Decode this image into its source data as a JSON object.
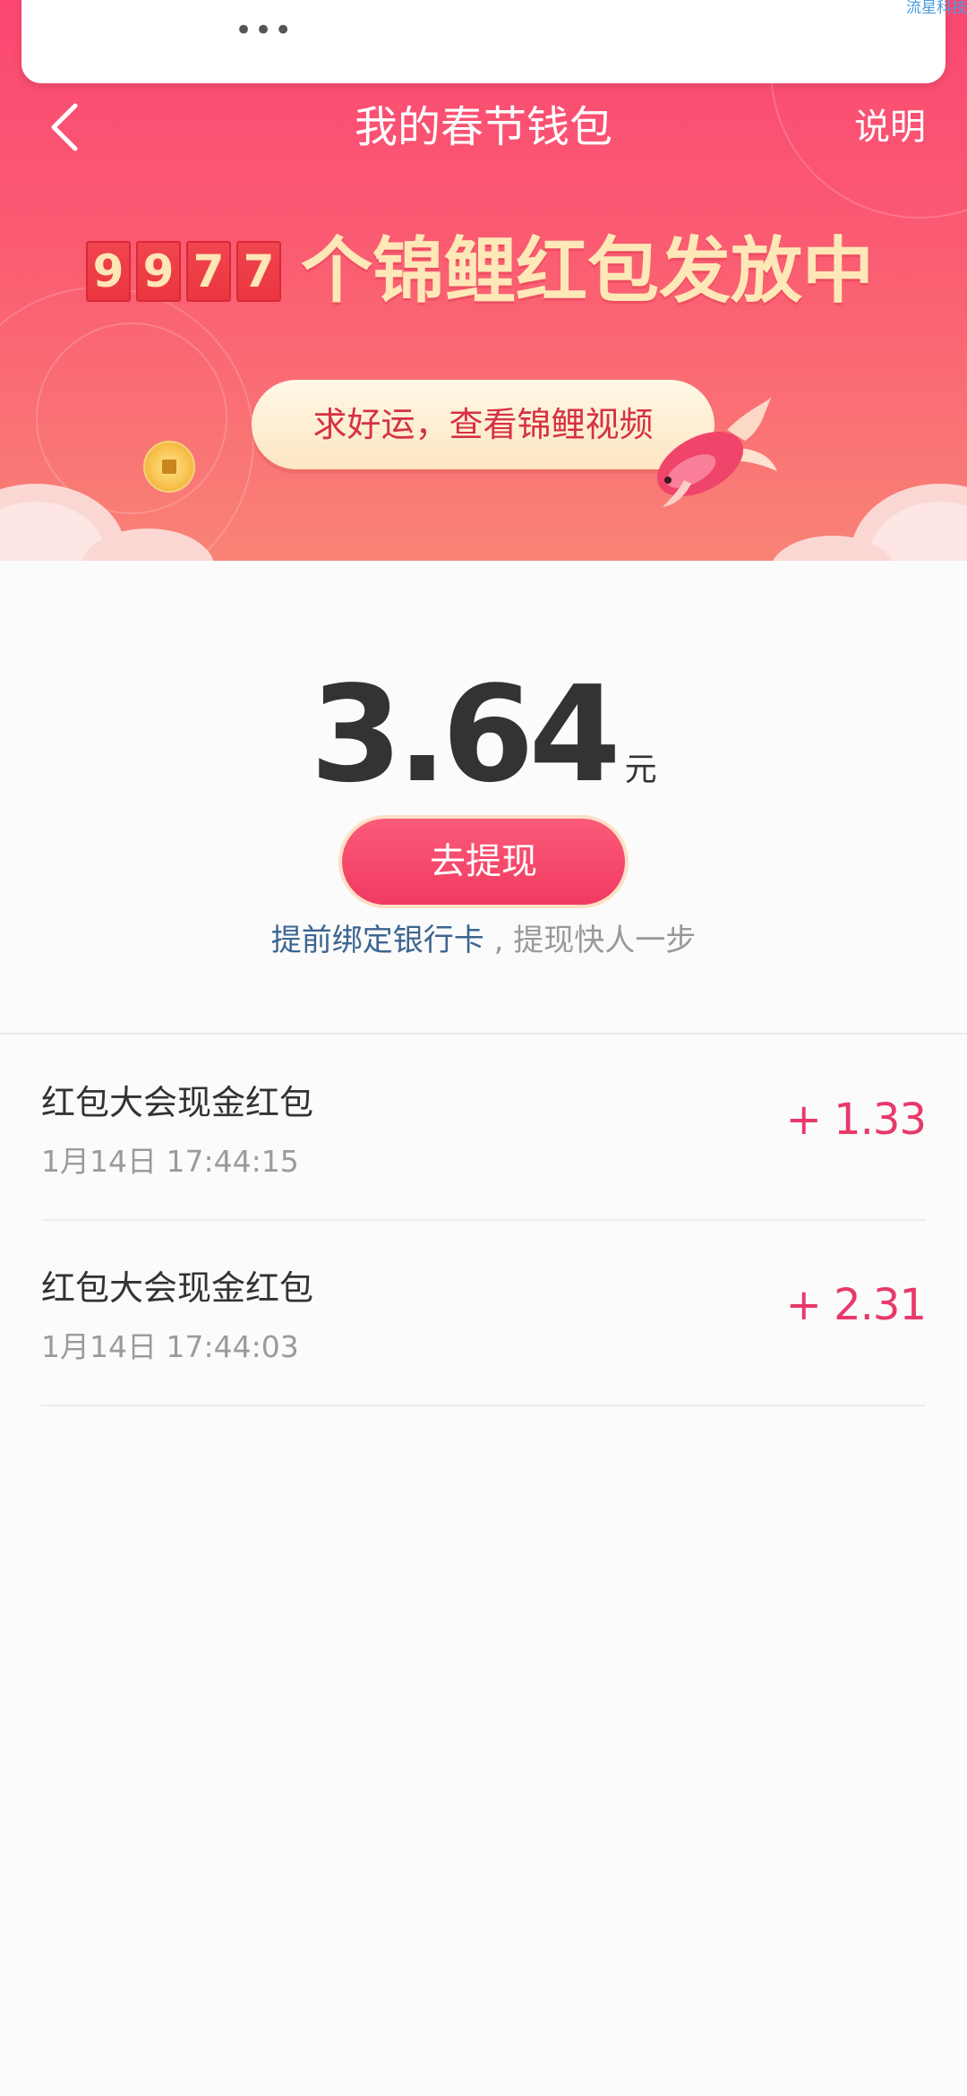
{
  "top_popup": {
    "more_label": "•••",
    "corner_text": "流星科技"
  },
  "nav": {
    "title": "我的春节钱包",
    "help_label": "说明"
  },
  "banner": {
    "counter_digits": [
      "9",
      "9",
      "7",
      "7"
    ],
    "counter_text": "个锦鲤红包发放中",
    "lucky_button_label": "求好运，查看锦鲤视频",
    "icons": [
      "coin-icon",
      "koi-fish-icon"
    ]
  },
  "wallet": {
    "balance": "3.64",
    "unit": "元",
    "withdraw_label": "去提现",
    "bind_link": "提前绑定银行卡",
    "bind_suffix": " , 提现快人一步"
  },
  "transactions": [
    {
      "title": "红包大会现金红包",
      "time": "1月14日 17:44:15",
      "amount": "+ 1.33"
    },
    {
      "title": "红包大会现金红包",
      "time": "1月14日 17:44:03",
      "amount": "+ 2.31"
    }
  ],
  "colors": {
    "brand_pink": "#fb4772",
    "amount_pink": "#e8396a",
    "link_blue": "#3c6591",
    "gold_text": "#ffe8b8"
  }
}
